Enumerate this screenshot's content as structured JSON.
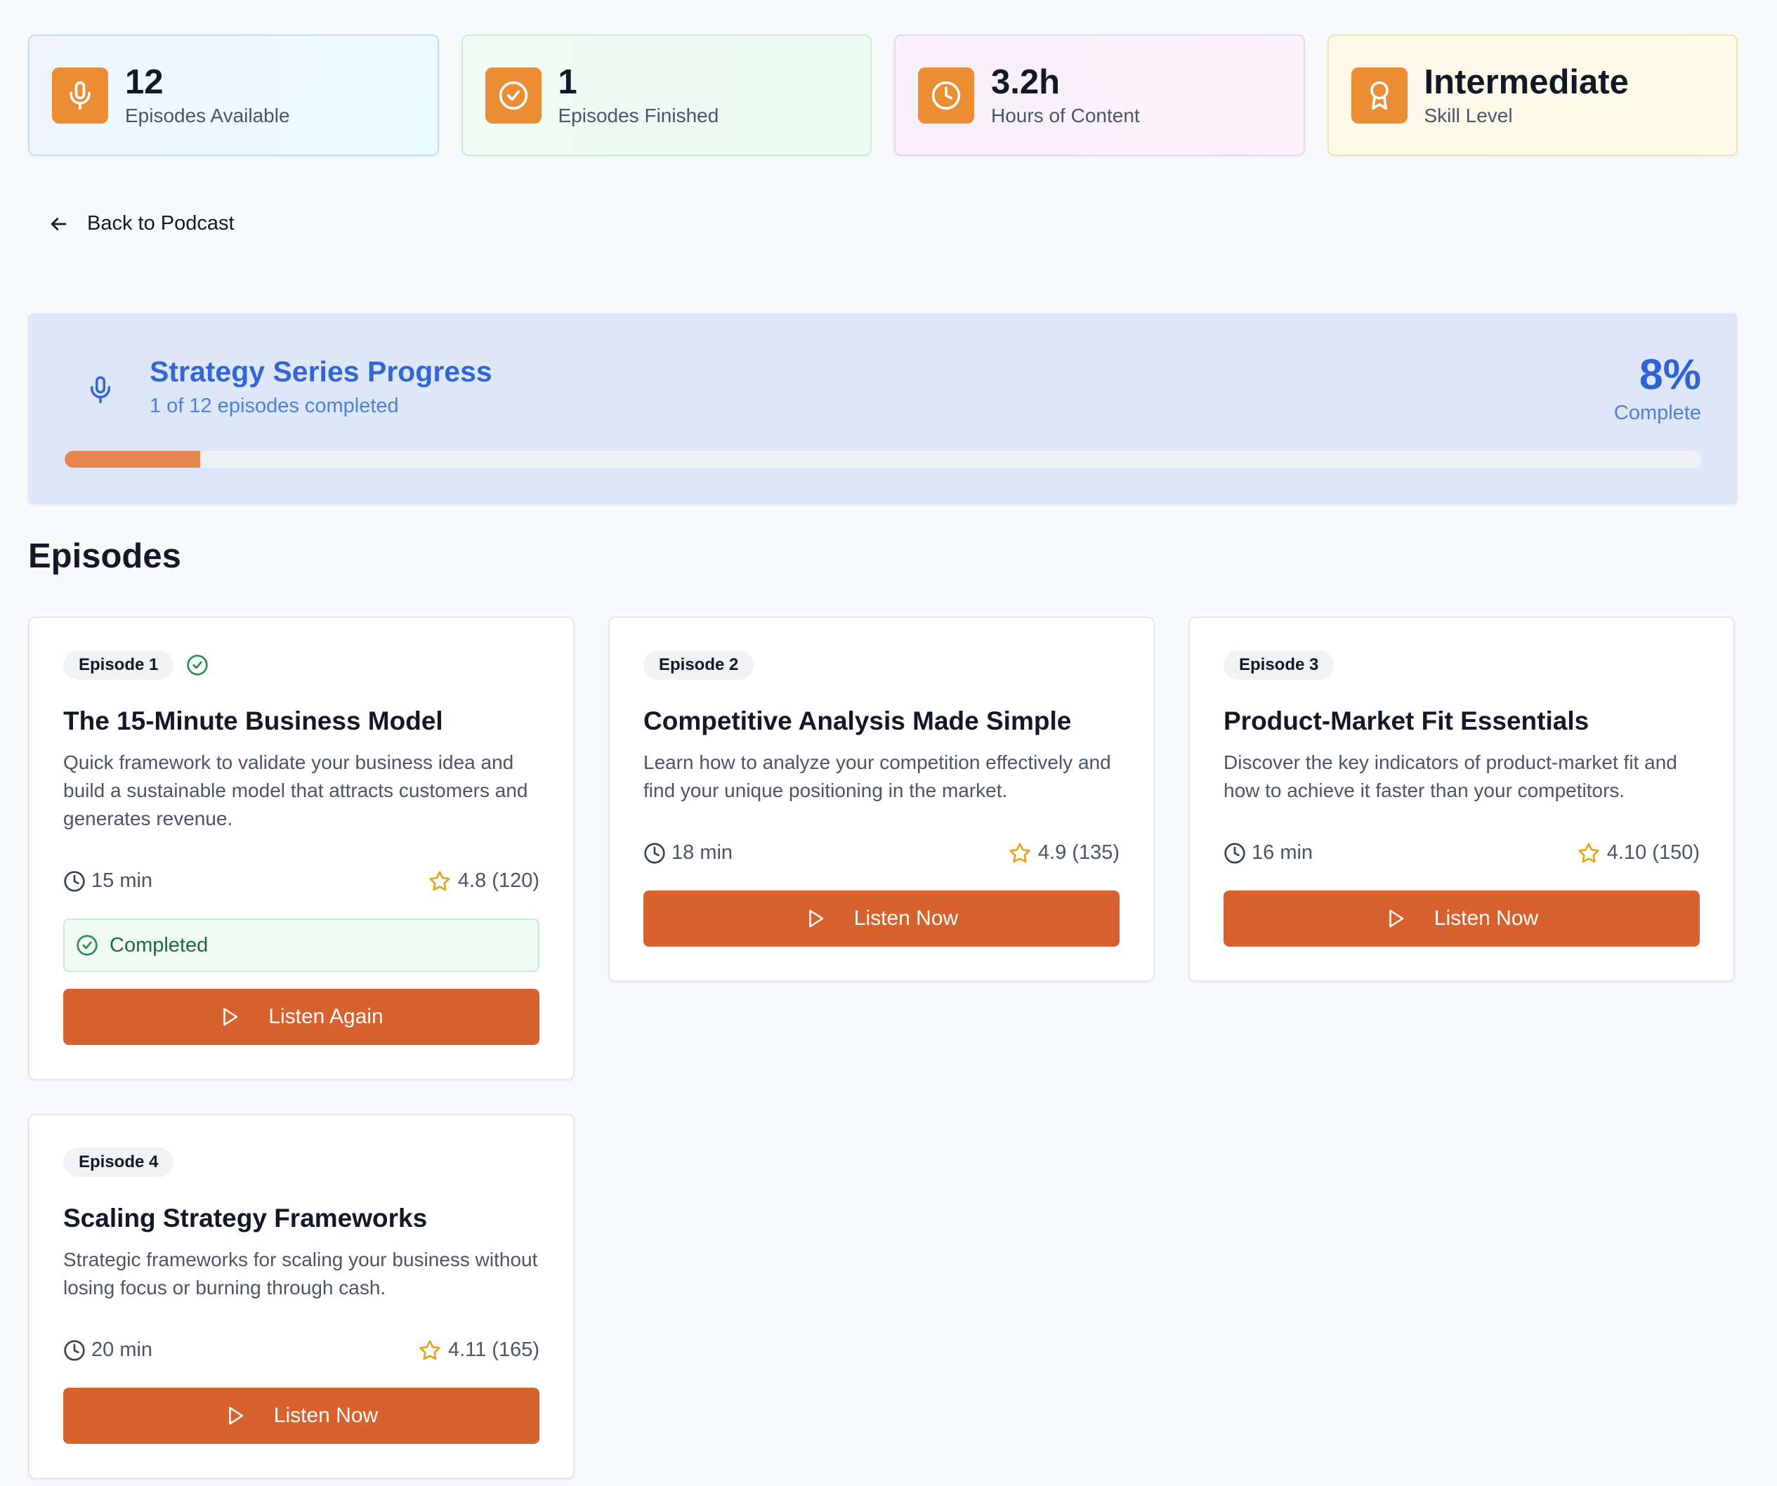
{
  "stats": [
    {
      "value": "12",
      "label": "Episodes Available",
      "icon": "microphone-icon"
    },
    {
      "value": "1",
      "label": "Episodes Finished",
      "icon": "check-circle-icon"
    },
    {
      "value": "3.2h",
      "label": "Hours of Content",
      "icon": "clock-icon"
    },
    {
      "value": "Intermediate",
      "label": "Skill Level",
      "icon": "award-icon"
    }
  ],
  "nav": {
    "back_label": "Back to Podcast"
  },
  "progress": {
    "title": "Strategy Series Progress",
    "subtitle": "1 of 12 episodes completed",
    "percent_label": "8%",
    "percent_value": 0.083,
    "complete_label": "Complete"
  },
  "episodes_section": {
    "title": "Episodes"
  },
  "episodes": [
    {
      "badge": "Episode 1",
      "title": "The 15-Minute Business Model",
      "description": "Quick framework to validate your business idea and build a sustainable model that attracts customers and generates revenue.",
      "duration": "15 min",
      "rating": "4.8 (120)",
      "completed": true,
      "completed_label": "Completed",
      "button_label": "Listen Again"
    },
    {
      "badge": "Episode 2",
      "title": "Competitive Analysis Made Simple",
      "description": "Learn how to analyze your competition effectively and find your unique positioning in the market.",
      "duration": "18 min",
      "rating": "4.9 (135)",
      "completed": false,
      "button_label": "Listen Now"
    },
    {
      "badge": "Episode 3",
      "title": "Product-Market Fit Essentials",
      "description": "Discover the key indicators of product-market fit and how to achieve it faster than your competitors.",
      "duration": "16 min",
      "rating": "4.10 (150)",
      "completed": false,
      "button_label": "Listen Now"
    },
    {
      "badge": "Episode 4",
      "title": "Scaling Strategy Frameworks",
      "description": "Strategic frameworks for scaling your business without losing focus or burning through cash.",
      "duration": "20 min",
      "rating": "4.11 (165)",
      "completed": false,
      "button_label": "Listen Now"
    }
  ],
  "colors": {
    "accent": "#d8622d",
    "icon_bg": "#ec8c33",
    "progress_fill": "#e5854f",
    "progress_text": "#3265d6",
    "star": "#e8a317",
    "success": "#2e8b4e"
  }
}
